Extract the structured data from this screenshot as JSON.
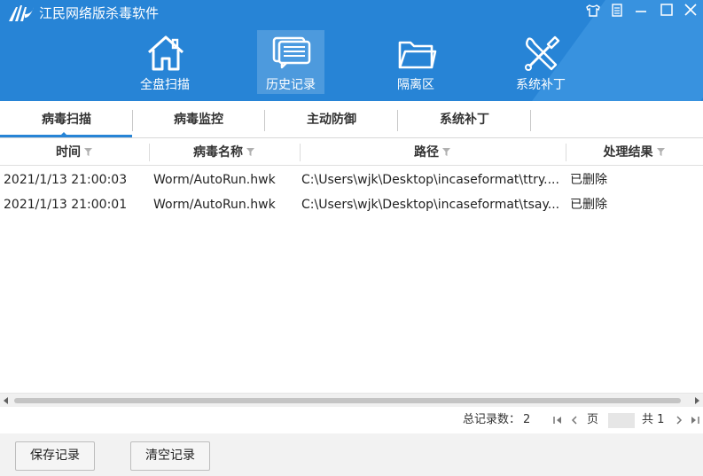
{
  "window": {
    "title": "江民网络版杀毒软件"
  },
  "nav": {
    "items": [
      {
        "label": "全盘扫描",
        "icon": "home-icon"
      },
      {
        "label": "历史记录",
        "icon": "history-icon",
        "active": true
      },
      {
        "label": "隔离区",
        "icon": "folder-icon"
      },
      {
        "label": "系统补丁",
        "icon": "tools-icon"
      }
    ]
  },
  "tabs": [
    {
      "label": "病毒扫描",
      "active": true
    },
    {
      "label": "病毒监控"
    },
    {
      "label": "主动防御"
    },
    {
      "label": "系统补丁"
    }
  ],
  "table": {
    "columns": [
      "时间",
      "病毒名称",
      "路径",
      "处理结果"
    ],
    "rows": [
      {
        "time": "2021/1/13 21:00:03",
        "name": "Worm/AutoRun.hwk",
        "path": "C:\\Users\\wjk\\Desktop\\incaseformat\\ttry....",
        "result": "已删除"
      },
      {
        "time": "2021/1/13 21:00:01",
        "name": "Worm/AutoRun.hwk",
        "path": "C:\\Users\\wjk\\Desktop\\incaseformat\\tsay...",
        "result": "已删除"
      }
    ]
  },
  "pager": {
    "total_label": "总记录数：",
    "total_value": "2",
    "page_label": "页",
    "page_value": "",
    "of_label": "共 1"
  },
  "buttons": {
    "save": "保存记录",
    "clear": "清空记录"
  },
  "colors": {
    "header_bg": "#2784d6",
    "accent": "#2784d6"
  }
}
